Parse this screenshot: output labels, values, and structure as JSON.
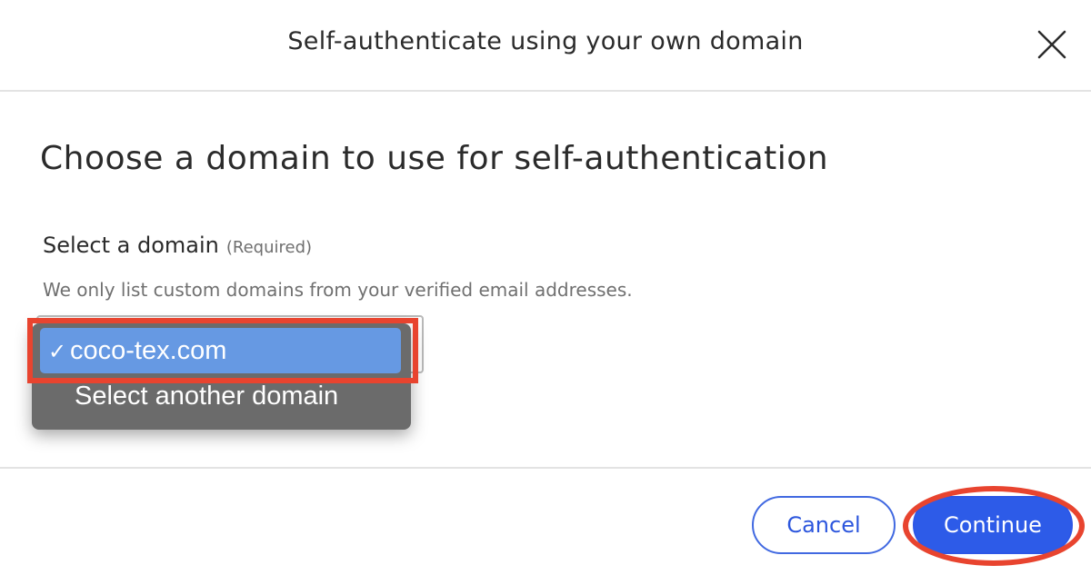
{
  "dialog": {
    "title": "Self-authenticate using your own domain",
    "close_icon": "close-icon"
  },
  "body": {
    "heading": "Choose a domain to use for self-authentication",
    "field": {
      "label": "Select a domain",
      "required_text": "(Required)",
      "help_text": "We only list custom domains from your verified email addresses."
    },
    "dropdown": {
      "options": [
        {
          "label": "coco-tex.com",
          "selected": true,
          "check": "✓"
        },
        {
          "label": "Select another domain",
          "selected": false
        }
      ]
    }
  },
  "footer": {
    "cancel_label": "Cancel",
    "continue_label": "Continue"
  },
  "colors": {
    "primary": "#2d5be8",
    "selected_option": "#6699e3",
    "menu_bg": "#6b6b6b",
    "annotation": "#e8442f"
  }
}
